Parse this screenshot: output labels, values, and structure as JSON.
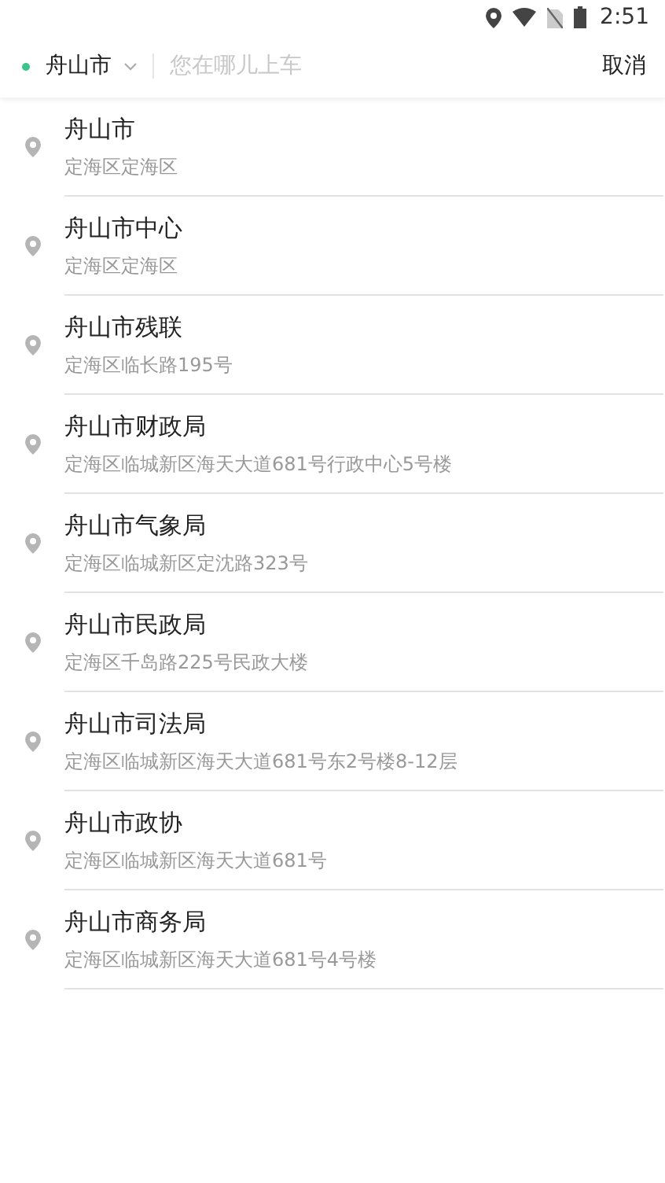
{
  "status_bar": {
    "time": "2:51"
  },
  "search_bar": {
    "city": "舟山市",
    "placeholder": "您在哪儿上车",
    "cancel": "取消"
  },
  "results": [
    {
      "name": "舟山市",
      "address": "定海区定海区"
    },
    {
      "name": "舟山市中心",
      "address": "定海区定海区"
    },
    {
      "name": "舟山市残联",
      "address": "定海区临长路195号"
    },
    {
      "name": "舟山市财政局",
      "address": "定海区临城新区海天大道681号行政中心5号楼"
    },
    {
      "name": "舟山市气象局",
      "address": "定海区临城新区定沈路323号"
    },
    {
      "name": "舟山市民政局",
      "address": "定海区千岛路225号民政大楼"
    },
    {
      "name": "舟山市司法局",
      "address": "定海区临城新区海天大道681号东2号楼8-12层"
    },
    {
      "name": "舟山市政协",
      "address": "定海区临城新区海天大道681号"
    },
    {
      "name": "舟山市商务局",
      "address": "定海区临城新区海天大道681号4号楼"
    }
  ]
}
